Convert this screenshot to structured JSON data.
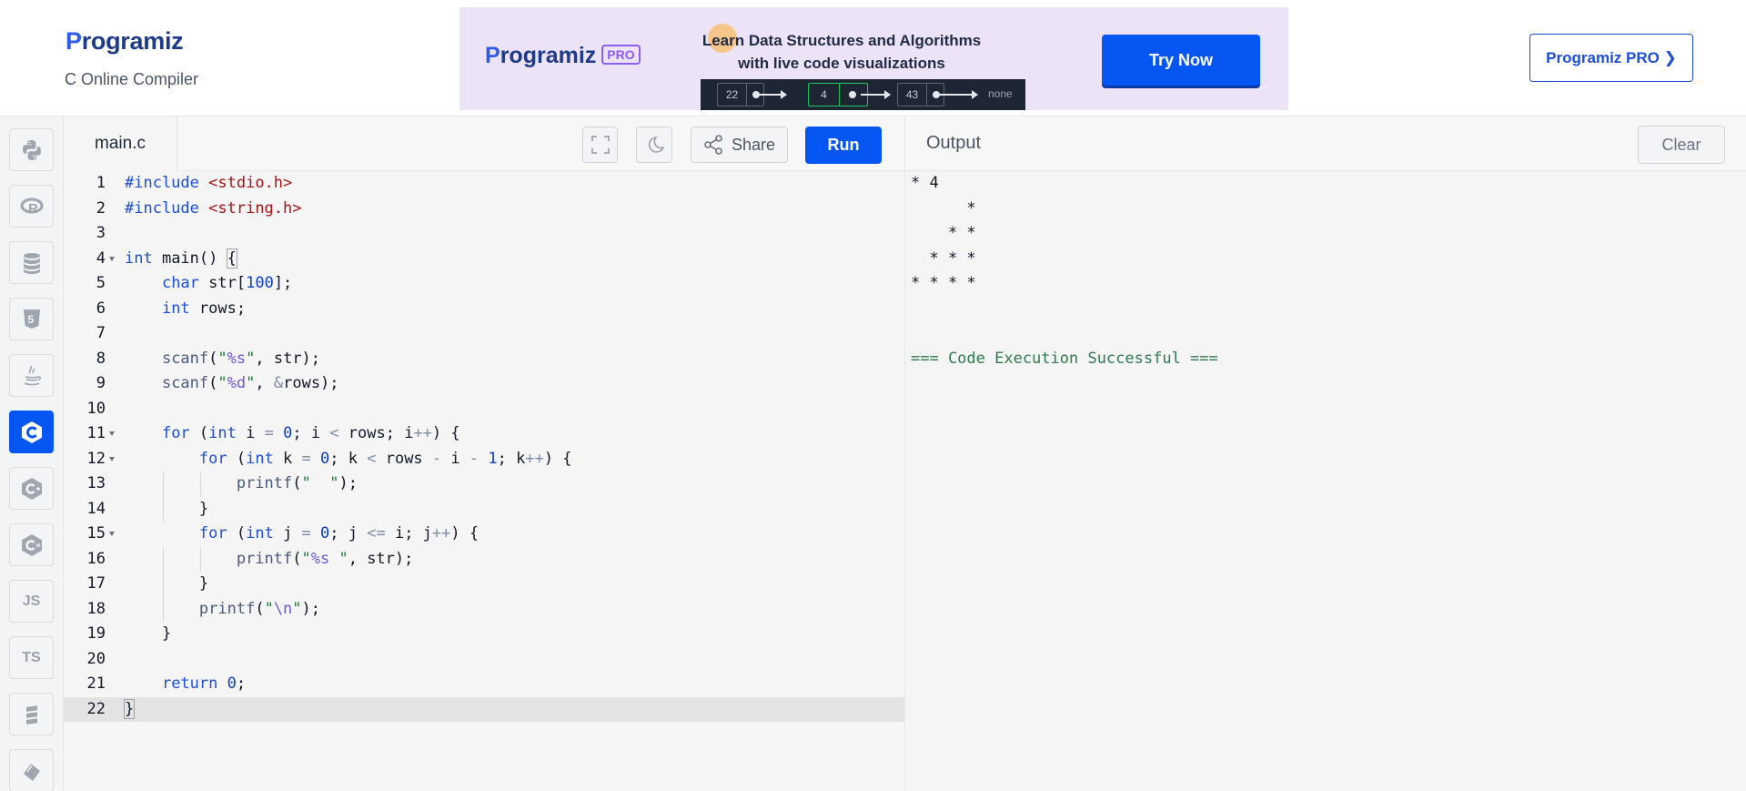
{
  "header": {
    "logo_text": "rogramiz",
    "logo_initial": "P",
    "subtitle": "C Online Compiler",
    "pro_button": "Programiz PRO ❯"
  },
  "banner": {
    "logo_initial": "P",
    "logo_text": "rogramiz",
    "pro_tag": "PRO",
    "line1": "Learn Data Structures and Algorithms",
    "line2": "with live code visualizations",
    "nodes": [
      "22",
      "4",
      "43"
    ],
    "none_label": "none",
    "cta": "Try Now"
  },
  "sidebar": {
    "items": [
      {
        "name": "python",
        "icon": "python-icon"
      },
      {
        "name": "r",
        "icon": "r-icon"
      },
      {
        "name": "sql",
        "icon": "database-icon"
      },
      {
        "name": "html",
        "icon": "html5-icon",
        "label": "5"
      },
      {
        "name": "java",
        "icon": "java-icon"
      },
      {
        "name": "c",
        "icon": "c-icon",
        "active": true
      },
      {
        "name": "cpp",
        "icon": "cpp-icon"
      },
      {
        "name": "csharp",
        "icon": "csharp-icon"
      },
      {
        "name": "js",
        "icon": "js-icon",
        "label": "JS"
      },
      {
        "name": "ts",
        "icon": "ts-icon",
        "label": "TS"
      },
      {
        "name": "go",
        "icon": "go-icon"
      },
      {
        "name": "swift",
        "icon": "swift-icon"
      }
    ]
  },
  "editor": {
    "file_name": "main.c",
    "share_label": "Share",
    "run_label": "Run",
    "line_numbers": [
      "1",
      "2",
      "3",
      "4",
      "5",
      "6",
      "7",
      "8",
      "9",
      "10",
      "11",
      "12",
      "13",
      "14",
      "15",
      "16",
      "17",
      "18",
      "19",
      "20",
      "21",
      "22"
    ],
    "code": [
      "#include <stdio.h>",
      "#include <string.h>",
      "",
      "int main() {",
      "    char str[100];",
      "    int rows;",
      "",
      "    scanf(\"%s\", str);",
      "    scanf(\"%d\", &rows);",
      "",
      "    for (int i = 0; i < rows; i++) {",
      "        for (int k = 0; k < rows - i - 1; k++) {",
      "            printf(\"  \");",
      "        }",
      "        for (int j = 0; j <= i; j++) {",
      "            printf(\"%s \", str);",
      "        }",
      "        printf(\"\\n\");",
      "    }",
      "",
      "    return 0;",
      "}"
    ],
    "current_line": 22
  },
  "output": {
    "title": "Output",
    "clear_label": "Clear",
    "lines": [
      "* 4",
      "      *",
      "    * *",
      "  * * *",
      "* * * *",
      "",
      "",
      "=== Code Execution Successful ==="
    ]
  },
  "colors": {
    "brand_blue": "#0556f3",
    "banner_bg": "#ede3f7",
    "editor_bg": "#f5f5f5",
    "success_green": "#2f7a4e"
  }
}
